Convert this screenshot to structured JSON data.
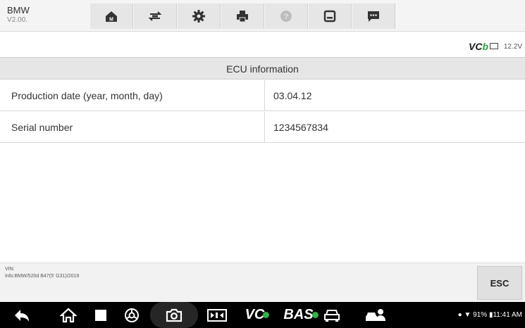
{
  "header": {
    "brand": "BMW",
    "version": "V2.00.",
    "toolbar": [
      {
        "name": "home-icon"
      },
      {
        "name": "vehicle-swap-icon"
      },
      {
        "name": "settings-gear-icon"
      },
      {
        "name": "print-icon"
      },
      {
        "name": "help-icon"
      },
      {
        "name": "save-icon"
      },
      {
        "name": "message-icon"
      }
    ]
  },
  "status": {
    "vci_label": "VC",
    "vci_suffix": "b",
    "voltage": "12.2V"
  },
  "table": {
    "title": "ECU information",
    "rows": [
      {
        "label": "Production date (year, month, day)",
        "value": "03.04.12"
      },
      {
        "label": "Serial number",
        "value": "1234567834"
      }
    ]
  },
  "info": {
    "vin_label": "VIN:",
    "info_text": "Info:BMW/520d B47(5' G31)/2019"
  },
  "footer": {
    "esc_label": "ESC"
  },
  "navbar": {
    "vci_text": "VC",
    "bas_text": "BAS",
    "battery": "91%",
    "time": "11:41 AM"
  },
  "colors": {
    "accent_green": "#2e9e3f",
    "toolbar_bg": "#e6e6e6",
    "navbar_bg": "#000000"
  }
}
